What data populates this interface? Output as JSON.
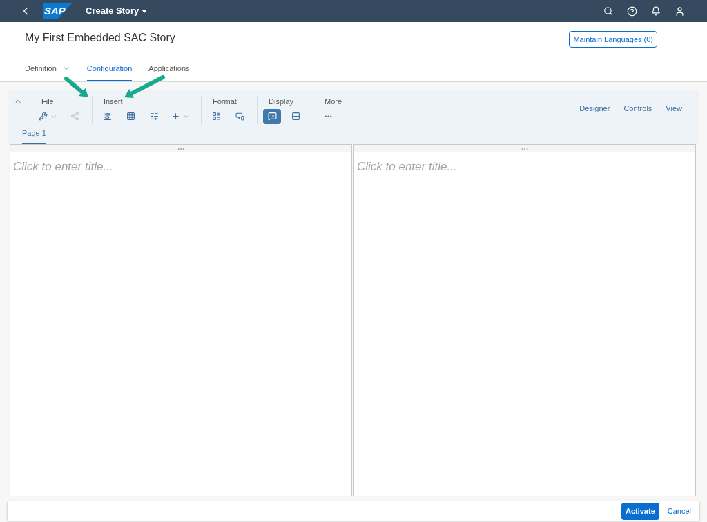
{
  "shell": {
    "logo": "SAP",
    "title": "Create Story"
  },
  "header": {
    "title": "My First Embedded SAC Story",
    "button": "Maintain Languages (0)"
  },
  "tabs": [
    {
      "label": "Definition",
      "selected": false,
      "menu": true
    },
    {
      "label": "Configuration",
      "selected": true,
      "menu": false
    },
    {
      "label": "Applications",
      "selected": false,
      "menu": false
    }
  ],
  "toolbar": {
    "expanded": true,
    "groups": [
      {
        "label": "File",
        "tools": [
          {
            "selected": false,
            "disabled": false,
            "menu": true
          },
          {
            "selected": false,
            "disabled": true,
            "menu": false
          }
        ]
      },
      {
        "label": "Insert",
        "tools": [
          {
            "selected": false,
            "disabled": false,
            "menu": false
          },
          {
            "selected": false,
            "disabled": false,
            "menu": false
          },
          {
            "selected": false,
            "disabled": false,
            "menu": false
          },
          {
            "selected": false,
            "disabled": false,
            "menu": true
          }
        ]
      },
      {
        "label": "Format",
        "tools": [
          {
            "selected": false,
            "disabled": false,
            "menu": false
          },
          {
            "selected": false,
            "disabled": false,
            "menu": false
          }
        ]
      },
      {
        "label": "Display",
        "tools": [
          {
            "selected": true,
            "disabled": false,
            "menu": false
          },
          {
            "selected": false,
            "disabled": false,
            "menu": false
          }
        ]
      },
      {
        "label": "More",
        "tools": [
          {
            "selected": false,
            "disabled": false,
            "menu": false
          }
        ]
      }
    ],
    "modes": [
      "Designer",
      "Controls",
      "View"
    ]
  },
  "pages": [
    {
      "label": "Page 1",
      "selected": true
    }
  ],
  "panels": [
    {
      "placeholder": "Click to enter title..."
    },
    {
      "placeholder": "Click to enter title..."
    }
  ],
  "footer": {
    "primary": "Activate",
    "secondary": "Cancel"
  }
}
